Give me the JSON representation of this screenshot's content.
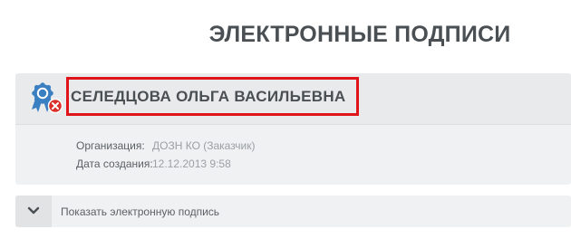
{
  "page": {
    "title": "ЭЛЕКТРОННЫЕ ПОДПИСИ"
  },
  "signature": {
    "icon": "certificate-invalid-icon",
    "name": "СЕЛЕДЦОВА ОЛЬГА ВАСИЛЬЕВНА",
    "details": [
      {
        "label": "Организация:",
        "value": "ДОЗН КО (Заказчик)"
      },
      {
        "label": "Дата создания:",
        "value": "12.12.2013 9:58"
      }
    ]
  },
  "toggle": {
    "icon": "chevron-down-icon",
    "label": "Показать электронную подпись"
  },
  "colors": {
    "highlight_border": "#e0151c",
    "icon_blue": "#3a7fc1",
    "error_red": "#d9302a"
  }
}
